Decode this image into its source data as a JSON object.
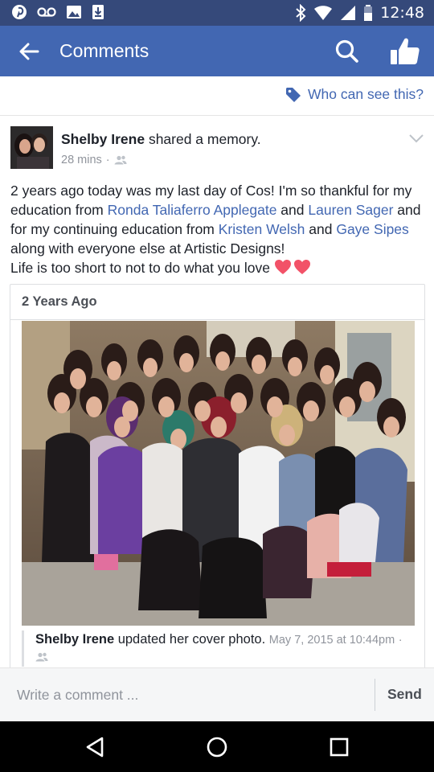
{
  "status_bar": {
    "time": "12:48",
    "left_icons": [
      "pinterest-icon",
      "voicemail-icon",
      "image-icon",
      "download-icon"
    ],
    "right_icons": [
      "bluetooth-icon",
      "wifi-icon",
      "signal-icon",
      "battery-icon"
    ]
  },
  "app_bar": {
    "title": "Comments",
    "icons": [
      "back-arrow-icon",
      "search-icon",
      "thumbs-up-icon"
    ]
  },
  "privacy": {
    "label": "Who can see this?",
    "icon": "tag-icon"
  },
  "post": {
    "author": "Shelby Irene",
    "action": " shared a memory.",
    "time": "28 mins",
    "meta_separator": "·",
    "audience_icon": "friends-icon",
    "body": {
      "p1": "2 years ago today was my last day of Cos! I'm so thankful for my education from ",
      "tag1": "Ronda Taliaferro Applegate",
      "p2": " and ",
      "tag2": "Lauren Sager",
      "p3": " and for my continuing education from ",
      "tag3": "Kristen Welsh",
      "p4": " and ",
      "tag4": "Gaye Sipes",
      "p5": " along with everyone else at Artistic Designs!",
      "p6": "Life is too short to not to do what you love "
    },
    "emoji": [
      "heart-icon",
      "heart-icon"
    ]
  },
  "memory_card": {
    "header": "2 Years Ago",
    "shared": {
      "author": "Shelby Irene",
      "action": " updated her cover photo.",
      "date": "May 7, 2015 at 10:44pm",
      "separator": "·"
    }
  },
  "comment_bar": {
    "placeholder": "Write a comment ...",
    "send_label": "Send"
  },
  "nav_bar": {
    "icons": [
      "back-triangle-icon",
      "home-circle-icon",
      "recents-square-icon"
    ]
  },
  "colors": {
    "status_bar": "#35497a",
    "app_bar": "#4267b2",
    "link": "#4267b2",
    "meta": "#90949c",
    "heart": "#f25268"
  }
}
